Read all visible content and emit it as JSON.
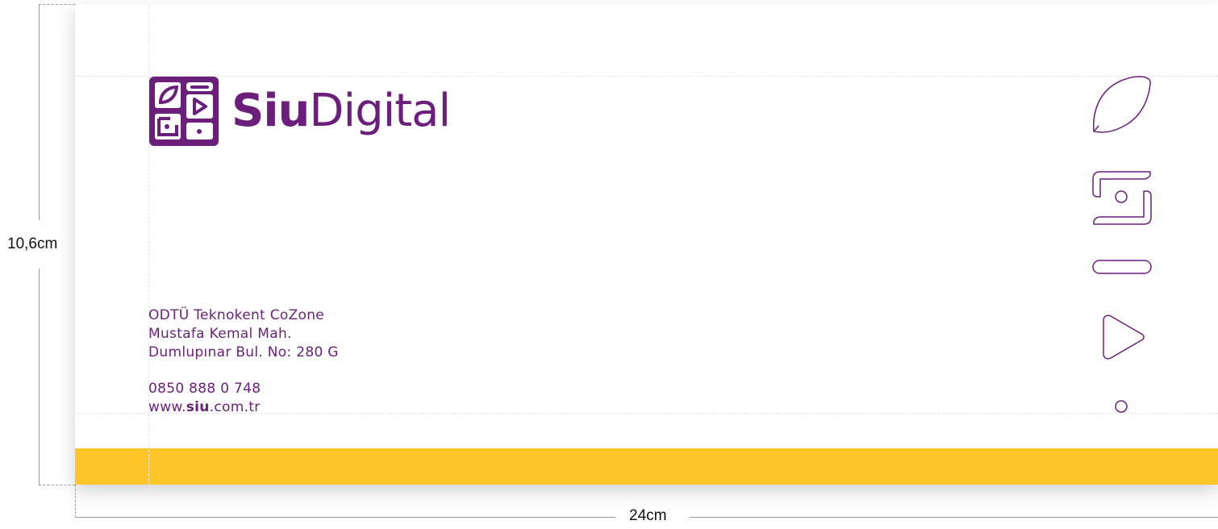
{
  "dimensions": {
    "height_label": "10,6cm",
    "width_label": "24cm"
  },
  "logo": {
    "text_bold": "Siu",
    "text_regular": "Digital"
  },
  "address": {
    "line1": "ODTÜ Teknokent CoZone",
    "line2": "Mustafa Kemal Mah.",
    "line3": "Dumlupınar Bul. No: 280 G"
  },
  "contact": {
    "phone": "0850 888 0 748",
    "web_prefix": "www.",
    "web_bold": "siu",
    "web_suffix": ".com.tr"
  },
  "colors": {
    "brand_purple": "#6B1F7B",
    "accent_yellow": "#FFC629"
  },
  "icons": [
    "leaf-outline-icon",
    "square-spiral-icon",
    "pill-bar-icon",
    "play-triangle-icon",
    "small-circle-icon"
  ]
}
